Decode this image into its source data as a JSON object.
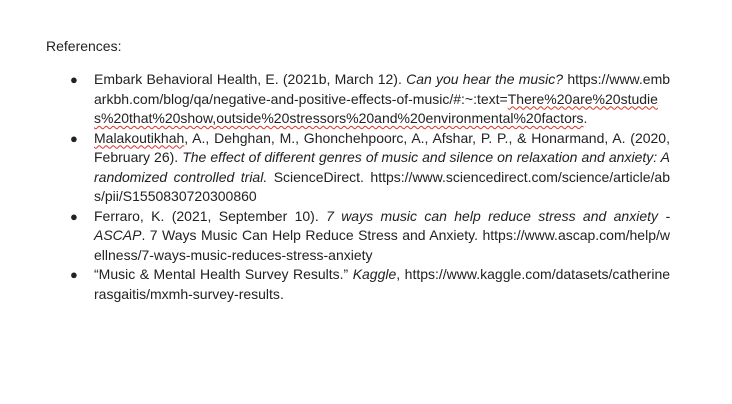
{
  "document": {
    "heading": "References:",
    "bullet_glyph": "●",
    "references": [
      {
        "author_date": "Embark Behavioral Health, E. (2021b, March 12). ",
        "title_italic": "Can you hear the music?",
        "after_title": " ",
        "url_plain": "https://www.embarkbh.com/blog/qa/negative-and-positive-effects-of-music/#:~:text=",
        "url_flagged": "There%20are%20studies%20that%20show,outside%20stressors%20and%20environmental%20factors",
        "end": "."
      },
      {
        "author_flagged": "Malakoutikhah",
        "author_rest": ", A., Dehghan, M., Ghonchehpoorc, A., Afshar, P. P., & Honarmand, A. (2020, February 26). ",
        "title_italic": "The effect of different genres of music and silence on relaxation and anxiety: A randomized controlled trial.",
        "after_title": " ScienceDirect. ",
        "url": "https://www.sciencedirect.com/science/article/abs/pii/S1550830720300860"
      },
      {
        "author_date": "Ferraro, K. (2021, September 10). ",
        "title_italic": "7 ways music can help reduce stress and anxiety - ASCAP",
        "after_title": ". 7 Ways Music Can Help Reduce Stress and Anxiety. ",
        "url": "https://www.ascap.com/help/wellness/7-ways-music-reduces-stress-anxiety"
      },
      {
        "lead": "“Music & Mental Health Survey Results.” ",
        "source_italic": "Kaggle",
        "after_source": ", ",
        "url": "https://www.kaggle.com/datasets/catherinerasgaitis/mxmh-survey-results",
        "end": "."
      }
    ]
  },
  "colors": {
    "text": "#222222",
    "spellcheck_underline": "#d93025",
    "background": "#ffffff"
  }
}
